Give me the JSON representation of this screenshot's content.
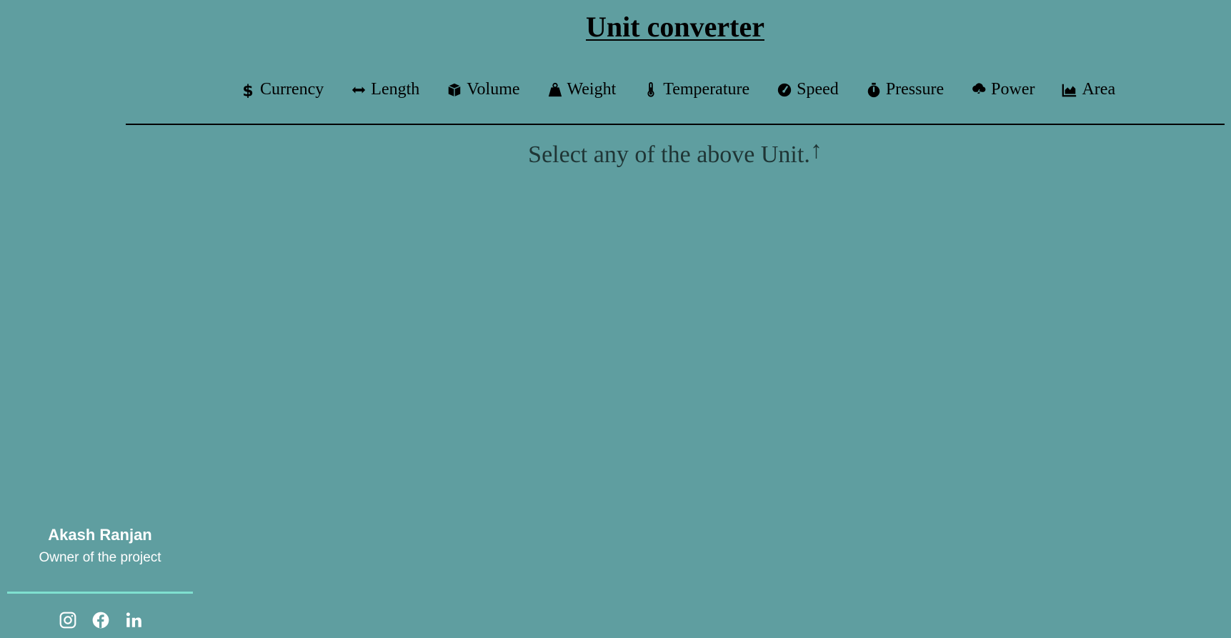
{
  "header": {
    "title": "Unit converter"
  },
  "nav": {
    "items": [
      {
        "label": "Currency",
        "icon": "dollar-icon"
      },
      {
        "label": "Length",
        "icon": "arrows-horizontal-icon"
      },
      {
        "label": "Volume",
        "icon": "cube-icon"
      },
      {
        "label": "Weight",
        "icon": "weight-icon"
      },
      {
        "label": "Temperature",
        "icon": "thermometer-icon"
      },
      {
        "label": "Speed",
        "icon": "gauge-icon"
      },
      {
        "label": "Pressure",
        "icon": "stopwatch-icon"
      },
      {
        "label": "Power",
        "icon": "cloud-bolt-icon"
      },
      {
        "label": "Area",
        "icon": "area-chart-icon"
      }
    ]
  },
  "main": {
    "message": "Select any of the above Unit.",
    "arrow": "↑"
  },
  "footer": {
    "owner_name": "Akash Ranjan",
    "owner_role": "Owner of the project",
    "socials": [
      "instagram-icon",
      "facebook-icon",
      "linkedin-icon"
    ]
  },
  "colors": {
    "background": "#5f9ea0",
    "footer_line": "#7fe0d0",
    "text": "#000000"
  }
}
